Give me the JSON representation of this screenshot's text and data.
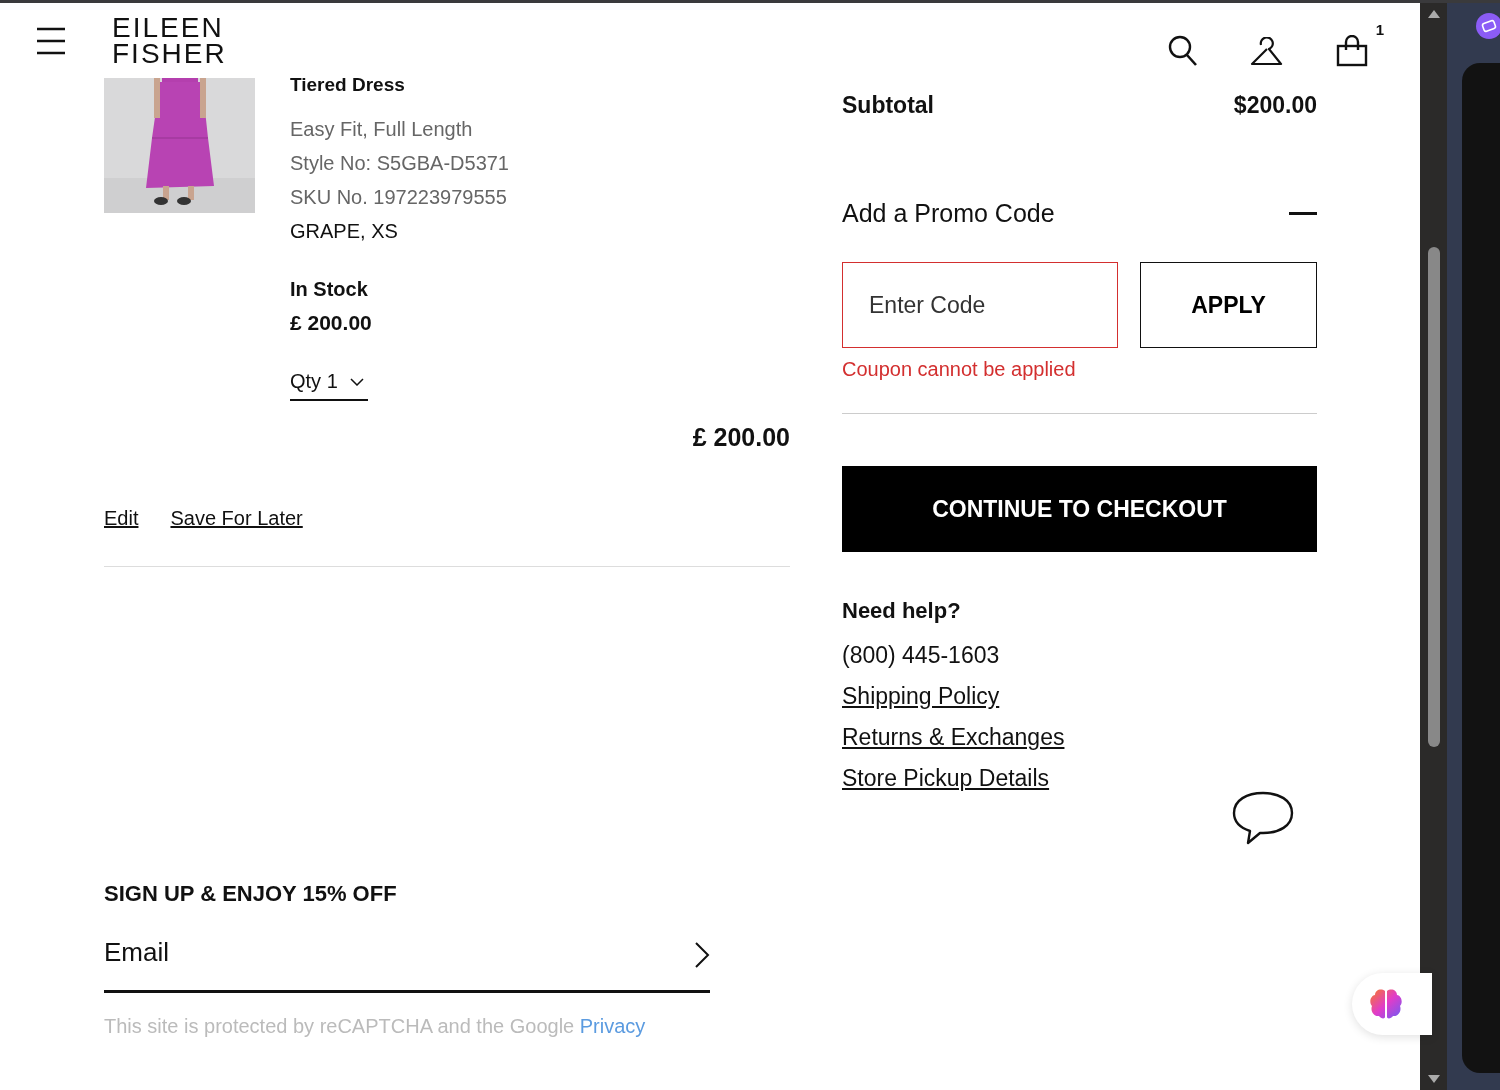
{
  "header": {
    "logo_lines": [
      "EILEEN",
      "FISHER"
    ],
    "cart_count": "1"
  },
  "item": {
    "title": "Tiered Dress",
    "fit": "Easy Fit, Full Length",
    "style": "Style No: S5GBA-D5371",
    "sku": "SKU No. 197223979555",
    "variant": "GRAPE, XS",
    "stock": "In Stock",
    "price": "£ 200.00",
    "qty": "Qty 1",
    "total": "£ 200.00",
    "actions": [
      "Edit",
      "Save For Later"
    ]
  },
  "summary": {
    "subtotal_label": "Subtotal",
    "subtotal": "$200.00",
    "promo": {
      "title": "Add a Promo Code",
      "expanded": true,
      "placeholder": "Enter Code",
      "button": "APPLY",
      "error": "Coupon cannot be applied"
    },
    "checkout": "CONTINUE TO CHECKOUT",
    "help": {
      "title": "Need help?",
      "phone": "(800) 445-1603",
      "links": [
        "Shipping Policy",
        "Returns & Exchanges",
        "Store Pickup Details"
      ]
    }
  },
  "signup": {
    "title": "SIGN UP & ENJOY 15% OFF",
    "placeholder": "Email",
    "notice": "This site is protected by reCAPTCHA and the Google",
    "notice_link": "Privacy"
  }
}
